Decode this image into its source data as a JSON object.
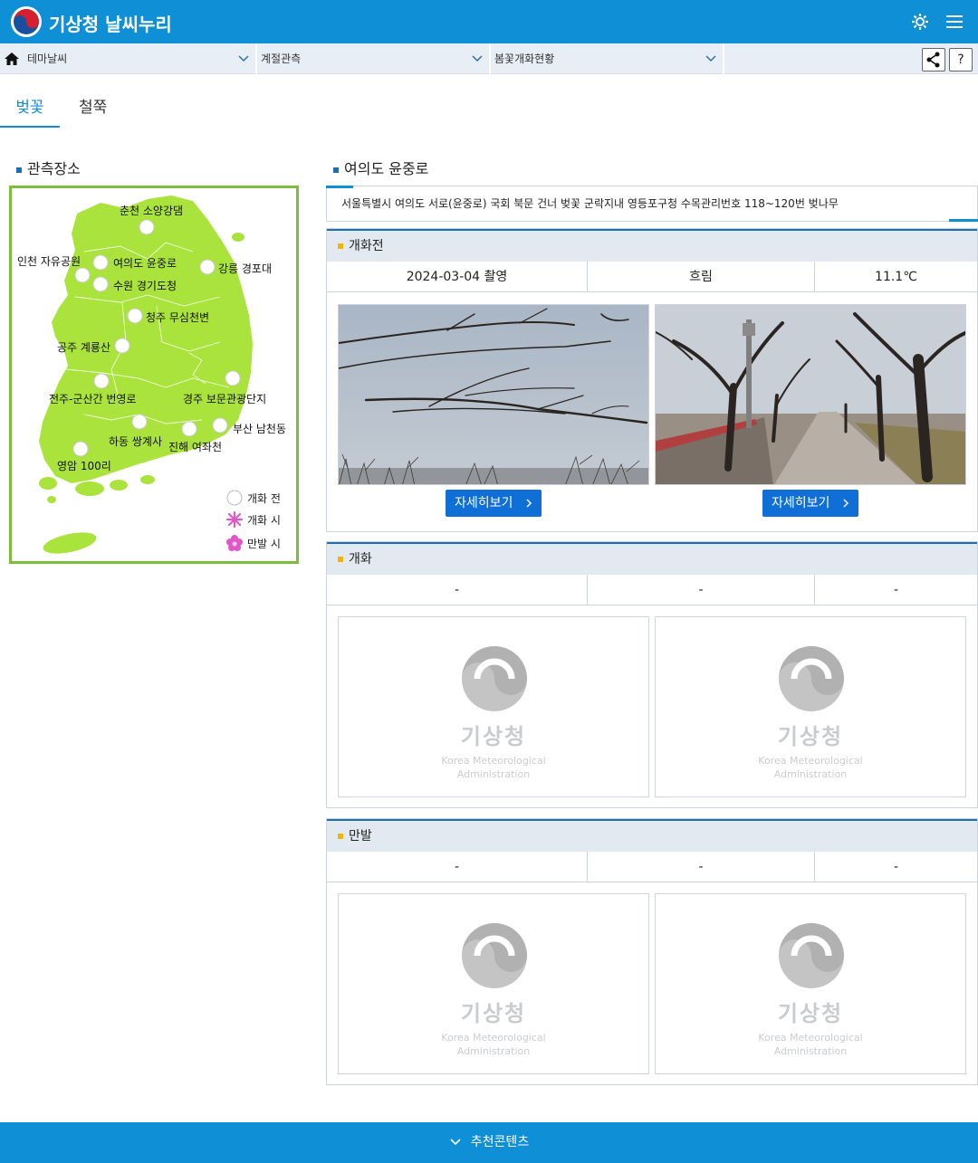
{
  "header": {
    "title": "기상청 날씨누리",
    "icons": [
      "settings-icon",
      "menu-icon"
    ],
    "accent": "#0f8fd6"
  },
  "breadcrumb": {
    "items": [
      "테마날씨",
      "계절관측",
      "봄꽃개화현황"
    ],
    "help": "?"
  },
  "tabs": [
    {
      "label": "벚꽃",
      "active": true
    },
    {
      "label": "철쭉",
      "active": false
    }
  ],
  "observation": {
    "heading": "관측장소",
    "sites": [
      "춘천 소양강댐",
      "인천 자유공원",
      "여의도 윤중로",
      "수원 경기도청",
      "강릉 경포대",
      "청주 무심천변",
      "공주 계룡산",
      "전주-군산간 번영로",
      "경주 보문관광단지",
      "부산 남천동",
      "하동 쌍계사",
      "진해 여좌천",
      "영암 100리"
    ],
    "legend": [
      "개화 전",
      "개화 시",
      "만발 시"
    ]
  },
  "site": {
    "name": "여의도 윤중로",
    "address": "서울특별시 여의도 서로(윤중로) 국회 북문 건너 벚꽃 군락지내 영등포구청 수목관리번호 118~120번 벚나무"
  },
  "stages": {
    "before": {
      "title": "개화전",
      "date": "2024-03-04 촬영",
      "weather": "흐림",
      "temp": "11.1℃",
      "detail_label": "자세히보기"
    },
    "bloom": {
      "title": "개화",
      "date": "-",
      "weather": "-",
      "temp": "-"
    },
    "full": {
      "title": "만발",
      "date": "-",
      "weather": "-",
      "temp": "-"
    }
  },
  "placeholder": {
    "title": "기상청",
    "sub1": "Korea Meteorological",
    "sub2": "Administration"
  },
  "footer": {
    "label": "추천콘텐츠"
  }
}
